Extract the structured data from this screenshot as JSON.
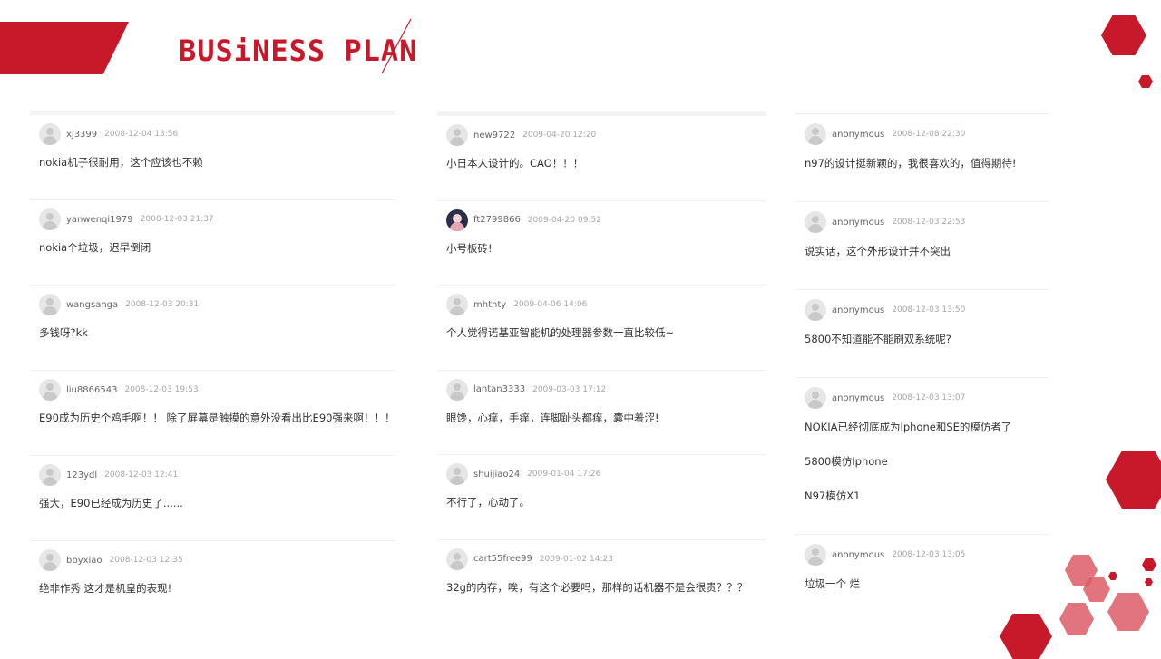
{
  "header": {
    "title": "BUSiNESS PLAN"
  },
  "colors": {
    "accent": "#c8192a",
    "accent_light": "#dc5c66"
  },
  "icons": {
    "avatar": "user-avatar-icon"
  },
  "columns": [
    [
      {
        "user": "xj3399",
        "time": "2008-12-04 13:56",
        "text": [
          "nokia机子很耐用，这个应该也不赖"
        ]
      },
      {
        "user": "yanwenqi1979",
        "time": "2008-12-03 21:37",
        "text": [
          "nokia个垃圾，迟早倒闭"
        ]
      },
      {
        "user": "wangsanga",
        "time": "2008-12-03 20:31",
        "text": [
          "多钱呀?kk"
        ]
      },
      {
        "user": "liu8866543",
        "time": "2008-12-03 19:53",
        "text": [
          "E90成为历史个鸡毛啊！！ 除了屏幕是触摸的意外没看出比E90强来啊！！！"
        ]
      },
      {
        "user": "123ydl",
        "time": "2008-12-03 12:41",
        "text": [
          "强大，E90已经成为历史了......"
        ]
      },
      {
        "user": "bbyxiao",
        "time": "2008-12-03 12:35",
        "text": [
          "绝非作秀 这才是机皇的表现!"
        ]
      }
    ],
    [
      {
        "user": "new9722",
        "time": "2009-04-20 12:20",
        "text": [
          "小日本人设计的。CAO！！！"
        ]
      },
      {
        "user": "ft2799866",
        "time": "2009-04-20 09:52",
        "text": [
          "小号板砖!"
        ],
        "photo": true
      },
      {
        "user": "mhthty",
        "time": "2009-04-06 14:06",
        "text": [
          "个人觉得诺基亚智能机的处理器参数一直比较低~"
        ]
      },
      {
        "user": "lantan3333",
        "time": "2009-03-03 17:12",
        "text": [
          "眼馋，心痒，手痒，连脚趾头都痒，囊中羞涩!"
        ]
      },
      {
        "user": "shuijiao24",
        "time": "2009-01-04 17:26",
        "text": [
          "不行了，心动了。"
        ]
      },
      {
        "user": "cart55free99",
        "time": "2009-01-02 14:23",
        "text": [
          "32g的内存，唉，有这个必要吗，那样的话机器不是会很贵？？？"
        ]
      }
    ],
    [
      {
        "user": "anonymous",
        "time": "2008-12-08 22:30",
        "text": [
          "n97的设计挺新颖的，我很喜欢的，值得期待!"
        ]
      },
      {
        "user": "anonymous",
        "time": "2008-12-03 22:53",
        "text": [
          "说实话，这个外形设计并不突出"
        ]
      },
      {
        "user": "anonymous",
        "time": "2008-12-03 13:50",
        "text": [
          "5800不知道能不能刷双系统呢?"
        ]
      },
      {
        "user": "anonymous",
        "time": "2008-12-03 13:07",
        "text": [
          "NOKIA已经彻底成为Iphone和SE的模仿者了",
          "5800模仿Iphone",
          "N97模仿X1"
        ]
      },
      {
        "user": "anonymous",
        "time": "2008-12-03 13:05",
        "text": [
          "垃圾一个 烂"
        ]
      }
    ]
  ]
}
